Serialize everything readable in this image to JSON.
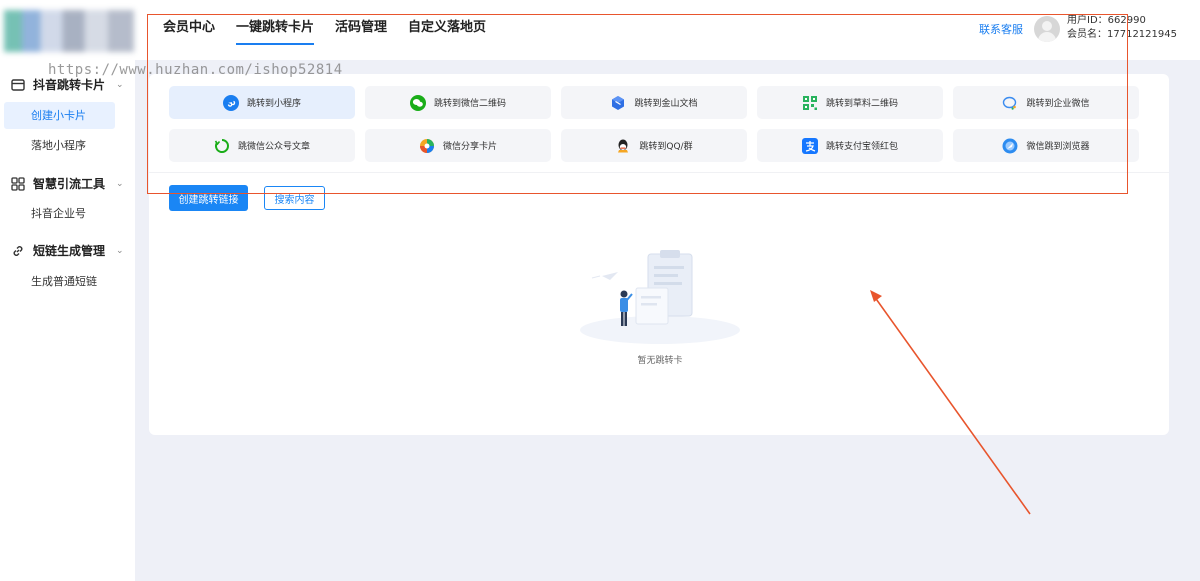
{
  "header": {
    "nav": [
      {
        "label": "会员中心"
      },
      {
        "label": "一键跳转卡片",
        "active": true
      },
      {
        "label": "活码管理"
      },
      {
        "label": "自定义落地页"
      }
    ],
    "support_label": "联系客服",
    "user_id_line": "用户ID：662990",
    "member_line": "会员名：17712121945"
  },
  "watermark": "https://www.huzhan.com/ishop52814",
  "sidebar": {
    "groups": [
      {
        "label": "抖音跳转卡片",
        "icon": "card-icon",
        "items": [
          {
            "label": "创建小卡片",
            "active": true
          },
          {
            "label": "落地小程序"
          }
        ]
      },
      {
        "label": "智慧引流工具",
        "icon": "grid-icon",
        "items": [
          {
            "label": "抖音企业号"
          }
        ]
      },
      {
        "label": "短链生成管理",
        "icon": "link-icon",
        "items": [
          {
            "label": "生成普通短链"
          }
        ]
      }
    ]
  },
  "main": {
    "jump_types": [
      {
        "label": "跳转到小程序",
        "icon": "miniprogram-icon",
        "color": "#1a7ef0",
        "active": true
      },
      {
        "label": "跳转到微信二维码",
        "icon": "wechat-icon",
        "color": "#1aad19"
      },
      {
        "label": "跳转到金山文档",
        "icon": "kdocs-icon",
        "color": "#2f6fe4"
      },
      {
        "label": "跳转到草料二维码",
        "icon": "qrcode-icon",
        "color": "#29b35e"
      },
      {
        "label": "跳转到企业微信",
        "icon": "wecom-icon",
        "color": "#3b8cf0"
      },
      {
        "label": "跳微信公众号文章",
        "icon": "official-account-icon",
        "color": "#1aad19"
      },
      {
        "label": "微信分享卡片",
        "icon": "share-card-icon",
        "color": "#f5a623"
      },
      {
        "label": "跳转到QQ/群",
        "icon": "qq-icon",
        "color": "#222222"
      },
      {
        "label": "跳转支付宝领红包",
        "icon": "alipay-icon",
        "color": "#1677ff"
      },
      {
        "label": "微信跳到浏览器",
        "icon": "browser-icon",
        "color": "#2d8cf0"
      }
    ],
    "create_button": "创建跳转链接",
    "search_button": "搜索内容",
    "empty_text": "暂无跳转卡"
  },
  "colors": {
    "accent": "#1a86f5",
    "annotation": "#e8552d",
    "page_bg": "#eef0f7"
  }
}
